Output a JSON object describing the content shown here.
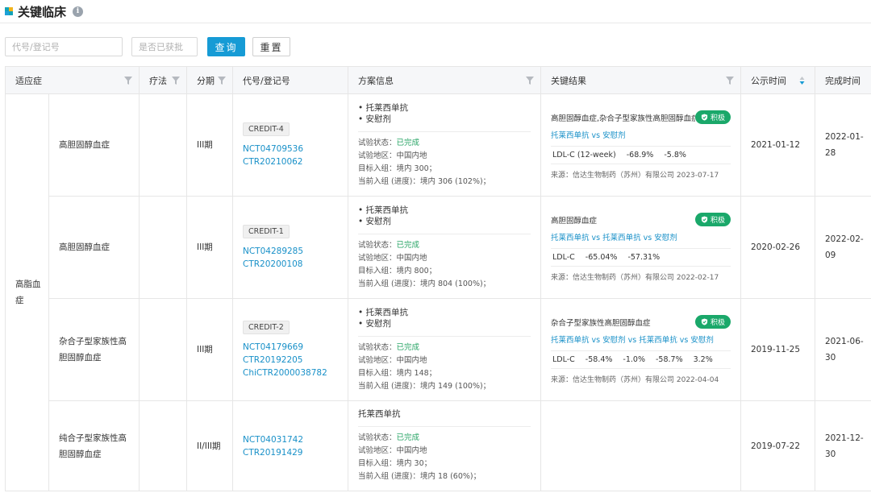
{
  "header": {
    "title": "关键临床",
    "info_icon": "info-icon"
  },
  "filters": {
    "code_placeholder": "代号/登记号",
    "approved_placeholder": "是否已获批",
    "search_label": "查询",
    "reset_label": "重置"
  },
  "columns": {
    "indication": "适应症",
    "therapy": "疗法",
    "phase": "分期",
    "code": "代号/登记号",
    "plan": "方案信息",
    "result": "关键结果",
    "publish": "公示时间",
    "complete": "完成时间"
  },
  "group_indication": "高脂血症",
  "labels": {
    "status": "试验状态：",
    "region": "试验地区：",
    "target": "目标入组：",
    "current": "当前入组 (进度)："
  },
  "rows": [
    {
      "sub_indication": "高胆固醇血症",
      "phase": "III期",
      "credit": "CREDIT-4",
      "codes": [
        "NCT04709536",
        "CTR20210062"
      ],
      "drugs": [
        "• 托莱西单抗",
        "• 安慰剂"
      ],
      "status": "已完成",
      "region": "中国内地",
      "target": "境内 300；",
      "current": "境内 306 (102%)；",
      "result_title": "高胆固醇血症,杂合子型家族性高胆固醇血症",
      "badge": "积极",
      "arms": "托莱西单抗 vs 安慰剂",
      "metrics": [
        "LDL-C (12-week)",
        "-68.9%",
        "-5.8%"
      ],
      "source": "来源：信达生物制药（苏州）有限公司   2023-07-17",
      "publish": "2021-01-12",
      "complete": "2022-01-28"
    },
    {
      "sub_indication": "高胆固醇血症",
      "phase": "III期",
      "credit": "CREDIT-1",
      "codes": [
        "NCT04289285",
        "CTR20200108"
      ],
      "drugs": [
        "• 托莱西单抗",
        "• 安慰剂"
      ],
      "status": "已完成",
      "region": "中国内地",
      "target": "境内 800；",
      "current": "境内 804 (100%)；",
      "result_title": "高胆固醇血症",
      "badge": "积极",
      "arms": "托莱西单抗 vs 托莱西单抗 vs 安慰剂",
      "metrics": [
        "LDL-C",
        "-65.04%",
        "-57.31%"
      ],
      "source": "来源：信达生物制药（苏州）有限公司   2022-02-17",
      "publish": "2020-02-26",
      "complete": "2022-02-09"
    },
    {
      "sub_indication": "杂合子型家族性高胆固醇血症",
      "phase": "III期",
      "credit": "CREDIT-2",
      "codes": [
        "NCT04179669",
        "CTR20192205",
        "ChiCTR2000038782"
      ],
      "drugs": [
        "• 托莱西单抗",
        "• 安慰剂"
      ],
      "status": "已完成",
      "region": "中国内地",
      "target": "境内 148；",
      "current": "境内 149 (100%)；",
      "result_title": "杂合子型家族性高胆固醇血症",
      "badge": "积极",
      "arms": "托莱西单抗 vs 安慰剂 vs 托莱西单抗 vs 安慰剂",
      "metrics": [
        "LDL-C",
        "-58.4%",
        "-1.0%",
        "-58.7%",
        "3.2%"
      ],
      "source": "来源：信达生物制药（苏州）有限公司   2022-04-04",
      "publish": "2019-11-25",
      "complete": "2021-06-30"
    },
    {
      "sub_indication": "纯合子型家族性高胆固醇血症",
      "phase": "II/III期",
      "codes": [
        "NCT04031742",
        "CTR20191429"
      ],
      "drug_plain": "托莱西单抗",
      "status": "已完成",
      "region": "中国内地",
      "target": "境内 30；",
      "current": "境内 18 (60%)；",
      "publish": "2019-07-22",
      "complete": "2021-12-30"
    }
  ],
  "colors": {
    "primary": "#169bd5",
    "link": "#1890c8",
    "success": "#27a465",
    "badge": "#1aa86a"
  }
}
